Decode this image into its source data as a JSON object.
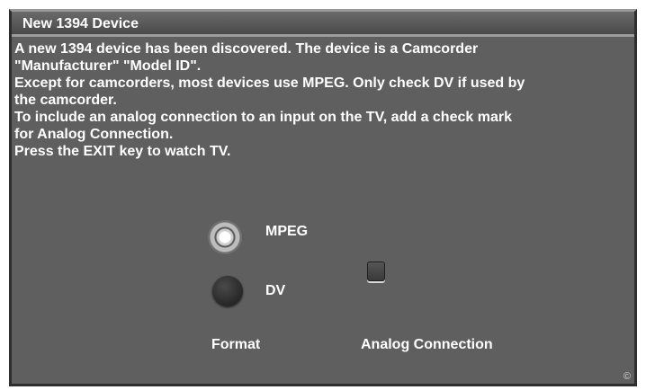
{
  "window": {
    "title": "New 1394 Device"
  },
  "message": {
    "lines": [
      "A new 1394 device has been discovered. The device is a Camcorder",
      " \"Manufacturer\" \"Model ID\".",
      "Except for camcorders, most devices use MPEG.  Only check DV if used by",
      "the camcorder.",
      "To include an analog connection to an input on the TV, add a check mark",
      "for Analog Connection.",
      "Press the EXIT key to watch TV."
    ]
  },
  "format": {
    "heading": "Format",
    "options": [
      {
        "label": "MPEG",
        "selected": true
      },
      {
        "label": "DV",
        "selected": false
      }
    ]
  },
  "analog": {
    "heading": "Analog Connection",
    "checked": false
  },
  "footer": {
    "mark": "©"
  },
  "colors": {
    "background": "#5f5f5f",
    "text": "#ffffff"
  }
}
